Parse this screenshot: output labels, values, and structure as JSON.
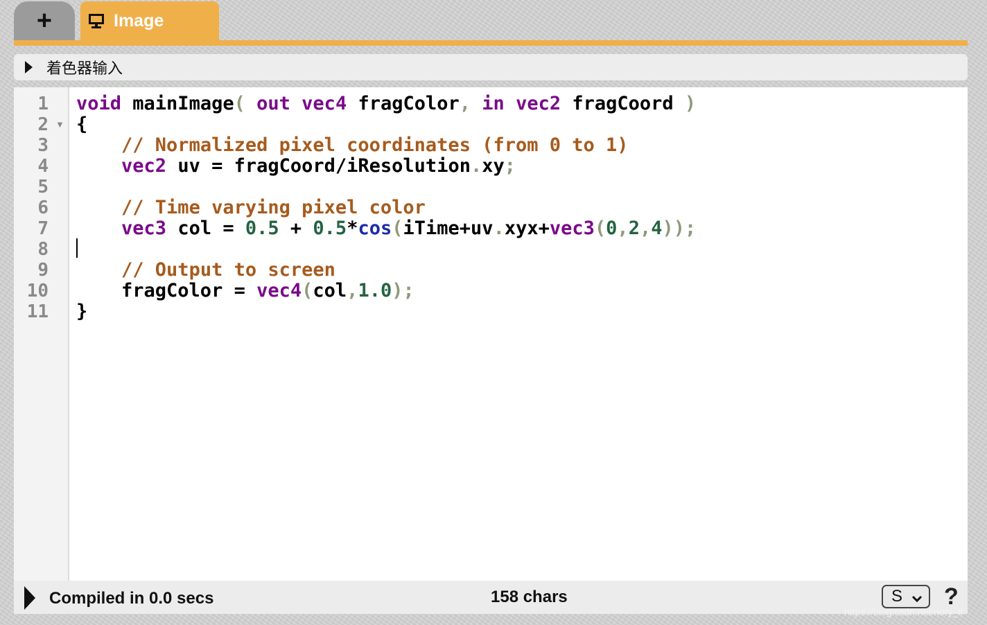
{
  "tabs": {
    "add_label": "+",
    "active_label": "Image"
  },
  "shader_inputs": {
    "label": "着色器输入"
  },
  "editor": {
    "line_numbers": [
      "1",
      "2",
      "3",
      "4",
      "5",
      "6",
      "7",
      "8",
      "9",
      "10",
      "11"
    ],
    "code_lines": [
      "void mainImage( out vec4 fragColor, in vec2 fragCoord )",
      "{",
      "    // Normalized pixel coordinates (from 0 to 1)",
      "    vec2 uv = fragCoord/iResolution.xy;",
      "",
      "    // Time varying pixel color",
      "    vec3 col = 0.5 + 0.5*cos(iTime+uv.xyx+vec3(0,2,4));",
      "",
      "    // Output to screen",
      "    fragColor = vec4(col,1.0);",
      "}"
    ],
    "colors": {
      "keyword": "#7a0a8a",
      "function": "#1c2ca6",
      "number": "#246342",
      "comment": "#a65b1e",
      "punctuation": "#8e9a7a"
    }
  },
  "status": {
    "compiled": "Compiled in 0.0 secs",
    "chars": "158 chars",
    "size_select": "S",
    "help": "?"
  },
  "watermark": "https://blog.csdn.net/nory_li",
  "accent_color": "#efb04a"
}
